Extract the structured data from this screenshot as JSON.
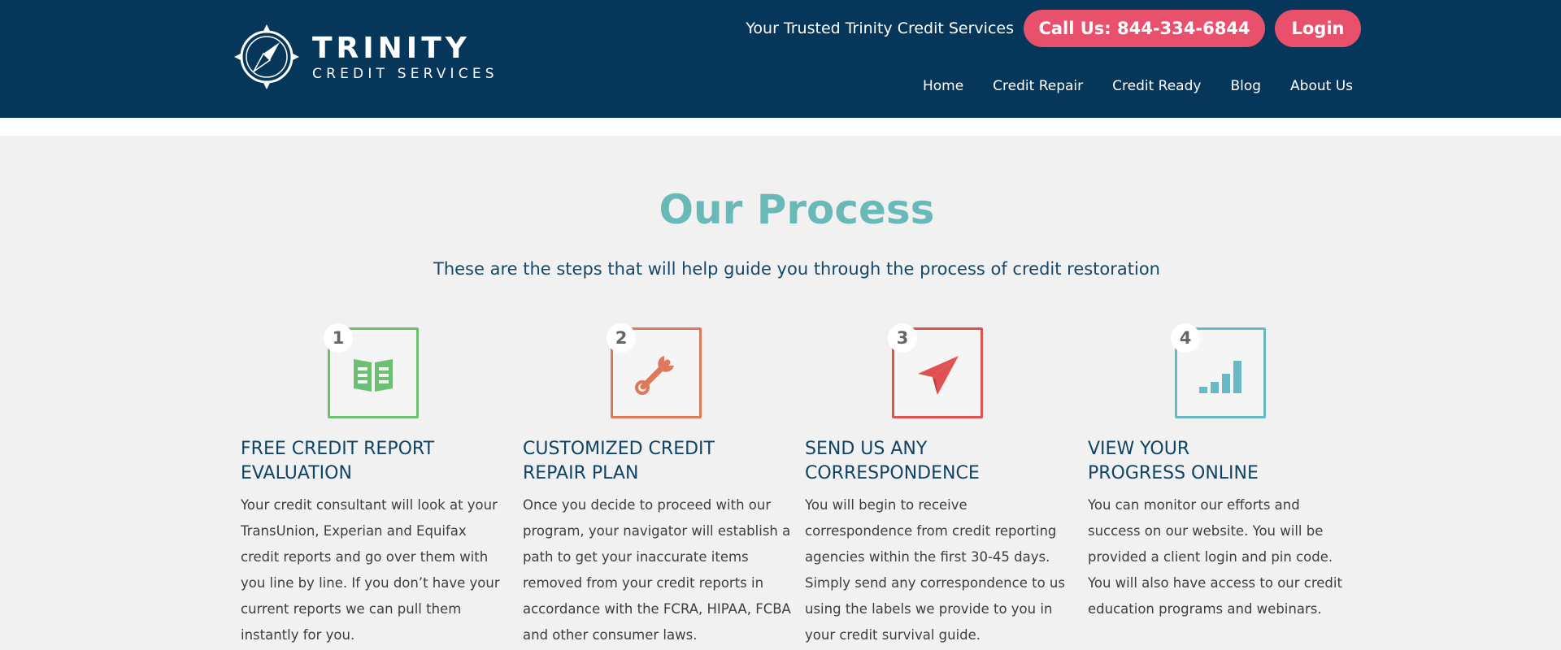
{
  "header": {
    "logo_title": "TRINITY",
    "logo_subtitle": "CREDIT SERVICES",
    "tagline": "Your Trusted Trinity Credit Services",
    "call_button": "Call Us: 844-334-6844",
    "login_button": "Login",
    "nav": [
      "Home",
      "Credit Repair",
      "Credit Ready",
      "Blog",
      "About Us"
    ]
  },
  "main": {
    "title": "Our Process",
    "subtitle": "These are the steps that will help guide you through the process of credit restoration",
    "steps": [
      {
        "number": "1",
        "icon": "book-icon",
        "color": "#6cbf73",
        "title_line1": "FREE CREDIT REPORT",
        "title_line2": "EVALUATION",
        "text": "Your credit consultant will look at your TransUnion, Experian and Equifax credit reports and go over them with you line by line. If you don’t have your current reports we can pull them instantly for you."
      },
      {
        "number": "2",
        "icon": "wrench-icon",
        "color": "#e0795b",
        "title_line1": "CUSTOMIZED CREDIT",
        "title_line2": "REPAIR PLAN",
        "text": "Once you decide to proceed with our program, your navigator will establish a path to get your inaccurate items removed from your credit reports in accordance with the FCRA, HIPAA, FCBA and other consumer laws."
      },
      {
        "number": "3",
        "icon": "paper-plane-icon",
        "color": "#e05252",
        "title_line1": "SEND US ANY",
        "title_line2": "CORRESPONDENCE",
        "text": "You will begin to receive correspondence from credit reporting agencies within the first 30-45 days. Simply send any correspondence to us using the labels we provide to you in your credit survival guide."
      },
      {
        "number": "4",
        "icon": "bar-chart-icon",
        "color": "#6ab9c2",
        "title_line1": "VIEW YOUR",
        "title_line2": "PROGRESS ONLINE",
        "text": "You can monitor our efforts and success on our website. You will be provided a client login and pin code. You will also have access to our credit education programs and webinars."
      }
    ]
  }
}
